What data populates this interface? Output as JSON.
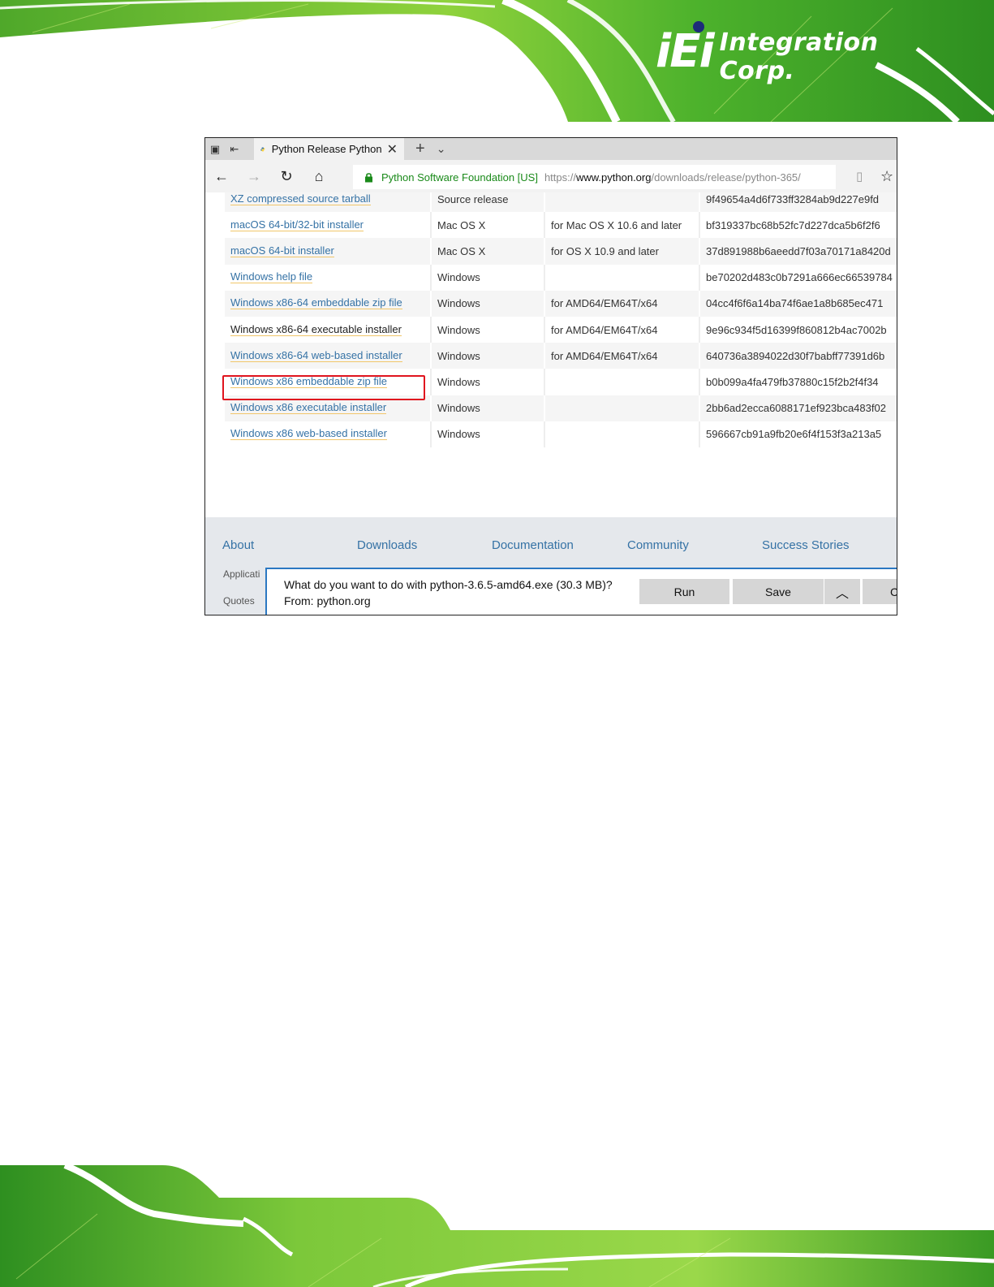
{
  "brand": {
    "logo_mark": "iEi",
    "logo_text": "Integration Corp.",
    "colors": {
      "green": "#5cb82e",
      "navy": "#1d2b7a"
    }
  },
  "browser": {
    "tab_title": "Python Release Python",
    "address": {
      "org": "Python Software Foundation [US]",
      "scheme": "https://",
      "host": "www.python.org",
      "path": "/downloads/release/python-365/"
    }
  },
  "table": {
    "rows": [
      {
        "name": "XZ compressed source tarball",
        "os": "Source release",
        "desc": "",
        "md5": "9f49654a4d6f733ff3284ab9d227e9fd"
      },
      {
        "name": "macOS 64-bit/32-bit installer",
        "os": "Mac OS X",
        "desc": "for Mac OS X 10.6 and later",
        "md5": "bf319337bc68b52fc7d227dca5b6f2f6"
      },
      {
        "name": "macOS 64-bit installer",
        "os": "Mac OS X",
        "desc": "for OS X 10.9 and later",
        "md5": "37d891988b6aeedd7f03a70171a8420d"
      },
      {
        "name": "Windows help file",
        "os": "Windows",
        "desc": "",
        "md5": "be70202d483c0b7291a666ec66539784"
      },
      {
        "name": "Windows x86-64 embeddable zip file",
        "os": "Windows",
        "desc": "for AMD64/EM64T/x64",
        "md5": "04cc4f6f6a14ba74f6ae1a8b685ec471"
      },
      {
        "name": "Windows x86-64 executable installer",
        "os": "Windows",
        "desc": "for AMD64/EM64T/x64",
        "md5": "9e96c934f5d16399f860812b4ac7002b"
      },
      {
        "name": "Windows x86-64 web-based installer",
        "os": "Windows",
        "desc": "for AMD64/EM64T/x64",
        "md5": "640736a3894022d30f7babff77391d6b"
      },
      {
        "name": "Windows x86 embeddable zip file",
        "os": "Windows",
        "desc": "",
        "md5": "b0b099a4fa479fb37880c15f2b2f4f34"
      },
      {
        "name": "Windows x86 executable installer",
        "os": "Windows",
        "desc": "",
        "md5": "2bb6ad2ecca6088171ef923bca483f02"
      },
      {
        "name": "Windows x86 web-based installer",
        "os": "Windows",
        "desc": "",
        "md5": "596667cb91a9fb20e6f4f153f3a213a5"
      }
    ],
    "highlight_color": "#e0141e"
  },
  "footer": {
    "nav": [
      "About",
      "Downloads",
      "Documentation",
      "Community",
      "Success Stories"
    ],
    "sub": [
      "Applicati",
      "Quotes"
    ]
  },
  "download_bar": {
    "question": "What do you want to do with python-3.6.5-amd64.exe (30.3 MB)?",
    "from": "From: python.org",
    "run": "Run",
    "save": "Save",
    "cancel": "C"
  }
}
